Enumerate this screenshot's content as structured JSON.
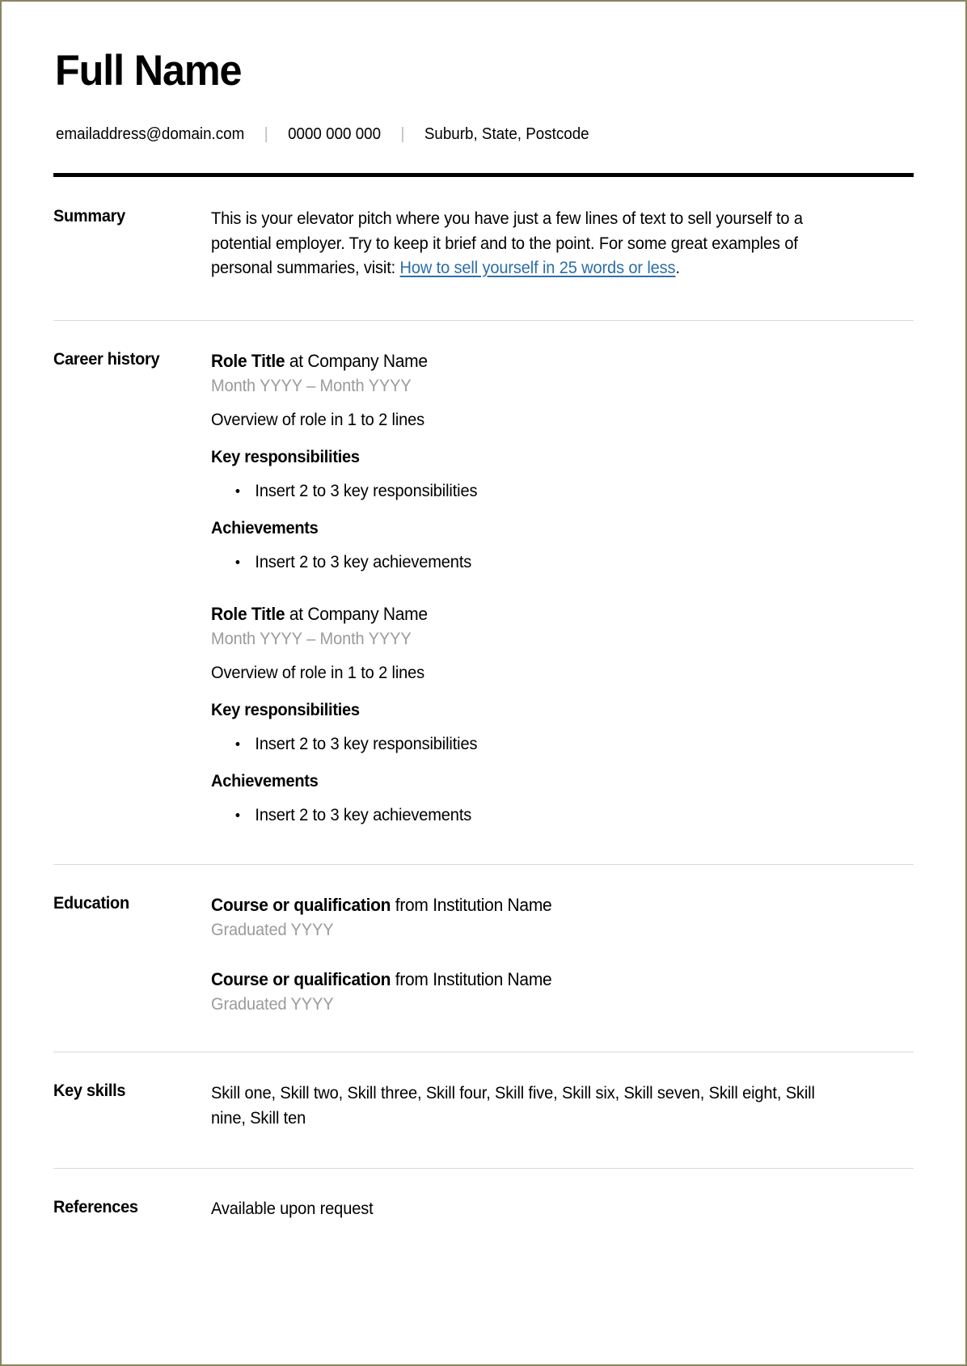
{
  "header": {
    "name": "Full Name",
    "contact": {
      "email": "emailaddress@domain.com",
      "phone": "0000 000 000",
      "location": "Suburb, State, Postcode",
      "separator": "|"
    }
  },
  "sections": {
    "summary": {
      "label": "Summary",
      "text_before_link": "This is your elevator pitch where you have just a few lines of text to sell yourself to a potential employer. Try to keep it brief and to the point. For some great examples of personal summaries, visit: ",
      "link_text": "How to sell yourself in 25 words or less",
      "text_after_link": "."
    },
    "career_history": {
      "label": "Career history",
      "roles": [
        {
          "title": "Role Title",
          "connector": " at ",
          "company": "Company Name",
          "dates": "Month YYYY – Month YYYY",
          "overview": "Overview of role in 1 to 2 lines",
          "responsibilities_heading": "Key responsibilities",
          "responsibilities": [
            "Insert 2 to 3 key responsibilities"
          ],
          "achievements_heading": "Achievements",
          "achievements": [
            "Insert 2 to 3 key achievements"
          ]
        },
        {
          "title": "Role Title",
          "connector": " at ",
          "company": "Company Name",
          "dates": "Month YYYY – Month YYYY",
          "overview": "Overview of role in 1 to 2 lines",
          "responsibilities_heading": "Key responsibilities",
          "responsibilities": [
            "Insert 2 to 3 key responsibilities"
          ],
          "achievements_heading": "Achievements",
          "achievements": [
            "Insert 2 to 3 key achievements"
          ]
        }
      ]
    },
    "education": {
      "label": "Education",
      "entries": [
        {
          "course": "Course or qualification",
          "connector": " from ",
          "institution": "Institution Name",
          "graduated": "Graduated YYYY"
        },
        {
          "course": "Course or qualification",
          "connector": " from ",
          "institution": "Institution Name",
          "graduated": "Graduated YYYY"
        }
      ]
    },
    "key_skills": {
      "label": "Key skills",
      "skills": [
        "Skill one",
        "Skill two",
        "Skill three",
        "Skill four",
        "Skill five",
        "Skill six",
        "Skill seven",
        "Skill eight",
        "Skill nine",
        "Skill ten"
      ],
      "text": "Skill one, Skill two, Skill three, Skill four, Skill five, Skill six, Skill seven, Skill eight, Skill nine, Skill ten"
    },
    "references": {
      "label": "References",
      "text": "Available upon request"
    }
  },
  "colors": {
    "link": "#2d6ea8",
    "muted_text": "#9b9b9b",
    "divider": "#d9d9d9",
    "header_rule": "#000000",
    "page_border": "#8a8560"
  }
}
